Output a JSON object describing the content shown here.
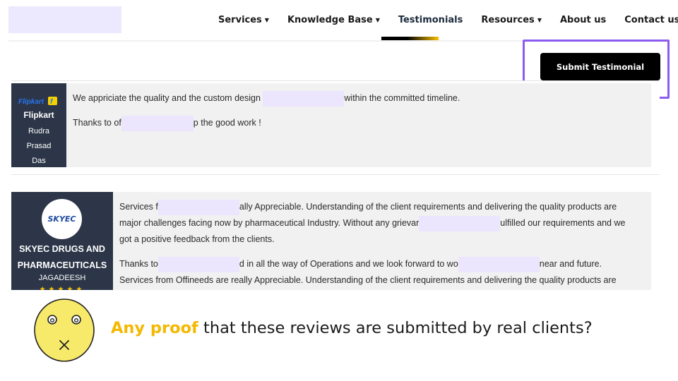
{
  "nav": {
    "items": [
      {
        "label": "Services",
        "dropdown": true
      },
      {
        "label": "Knowledge Base",
        "dropdown": true
      },
      {
        "label": "Testimonials",
        "dropdown": false,
        "active": true
      },
      {
        "label": "Resources",
        "dropdown": true
      },
      {
        "label": "About us",
        "dropdown": false
      },
      {
        "label": "Contact us",
        "dropdown": false
      }
    ],
    "chevron": "⌄"
  },
  "submit_label": "Submit Testimonial",
  "testimonials": [
    {
      "logo_text": "Flipkart",
      "company": "Flipkart",
      "person_lines": [
        "Rudra",
        "Prasad",
        "Das"
      ],
      "line1_a": "We appriciate the quality and the custom design",
      "line1_b": "within the committed timeline.",
      "line2_a": "Thanks to of",
      "line2_b": "p the good work !"
    },
    {
      "logo_text": "SKYEC",
      "company_lines": [
        "SKYEC DRUGS AND",
        "PHARMACEUTICALS"
      ],
      "person": "JAGADEESH",
      "stars": "★★★★★",
      "lines": [
        {
          "a": "Services f",
          "b": "ally Appreciable. Understanding of the client requirements and delivering the quality products are"
        },
        {
          "a": "major challenges facing now by pharmaceutical Industry. Without any grievar",
          "b": "ulfilled our requirements and we"
        },
        {
          "a": "got a positive feedback from the clients."
        },
        {
          "a": "Thanks to",
          "b": "d in all the way of Operations and we look forward to wo",
          "c": "near and future."
        },
        {
          "a": "Services from Offineeds are really Appreciable. Understanding of the client requirements and delivering the quality products are"
        }
      ]
    }
  ],
  "caption": {
    "highlight": "Any proof",
    "rest": " that these reviews are submitted by real clients?"
  },
  "colors": {
    "accent": "#f5b800",
    "highlight_border": "#8c5bf0",
    "sidebar": "#2c3648",
    "redaction": "#ebe5fd"
  }
}
